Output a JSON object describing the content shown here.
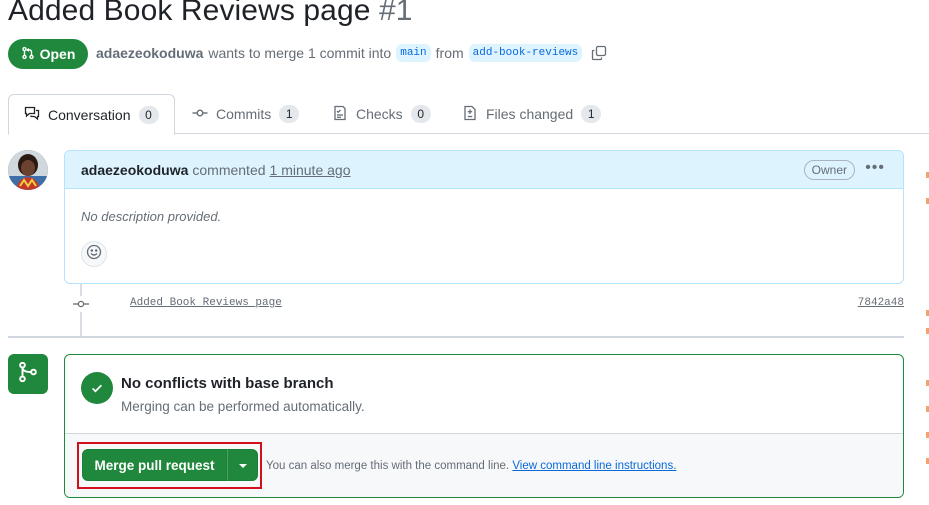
{
  "pr": {
    "title": "Added Book Reviews page",
    "number": "#1",
    "state": "Open",
    "author": "adaezeokoduwa",
    "merge_text_1": "wants to merge 1 commit into",
    "base_branch": "main",
    "merge_text_2": "from",
    "head_branch": "add-book-reviews"
  },
  "tabs": [
    {
      "label": "Conversation",
      "count": "0",
      "icon": "conversation-icon",
      "active": true
    },
    {
      "label": "Commits",
      "count": "1",
      "icon": "commit-icon",
      "active": false
    },
    {
      "label": "Checks",
      "count": "0",
      "icon": "checklist-icon",
      "active": false
    },
    {
      "label": "Files changed",
      "count": "1",
      "icon": "file-diff-icon",
      "active": false
    }
  ],
  "comment": {
    "author": "adaezeokoduwa",
    "action": "commented",
    "time": "1 minute ago",
    "role_badge": "Owner",
    "body": "No description provided."
  },
  "commit": {
    "message": "Added Book Reviews page",
    "sha": "7842a48"
  },
  "merge_box": {
    "title": "No conflicts with base branch",
    "subtitle": "Merging can be performed automatically.",
    "button_label": "Merge pull request",
    "cli_hint": "You can also merge this with the command line.",
    "cli_link": "View command line instructions."
  },
  "colors": {
    "accent_green": "#1f883d",
    "link_blue": "#0969da",
    "comment_header_bg": "#ddf4ff",
    "highlight_red": "#d1101b"
  }
}
